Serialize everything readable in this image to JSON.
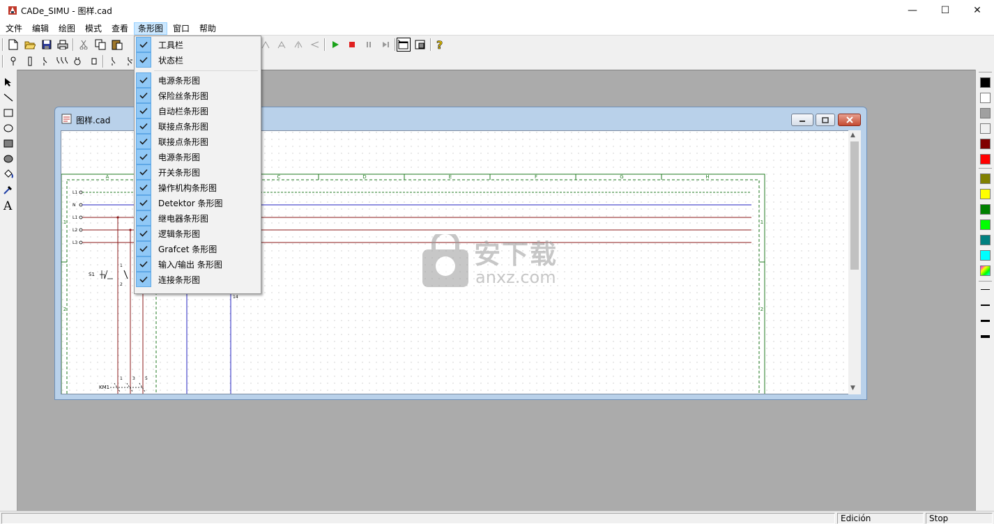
{
  "window": {
    "title": "CADe_SIMU - 图样.cad",
    "minimize": "—",
    "maximize": "☐",
    "close": "✕"
  },
  "menu": [
    {
      "label": "文件"
    },
    {
      "label": "编辑"
    },
    {
      "label": "绘图"
    },
    {
      "label": "模式"
    },
    {
      "label": "查看"
    },
    {
      "label": "条形图",
      "active": true
    },
    {
      "label": "窗口"
    },
    {
      "label": "帮助"
    }
  ],
  "dropdown": {
    "group1": [
      "工具栏",
      "状态栏"
    ],
    "group2": [
      "电源条形图",
      "保险丝条形图",
      "自动栏条形图",
      "联接点条形图",
      "联接点条形图",
      "电源条形图",
      "开关条形图",
      "操作机构条形图",
      "Detektor 条形图",
      "继电器条形图",
      "逻辑条形图",
      "Grafcet 条形图",
      "输入/输出 条形图",
      "连接条形图"
    ]
  },
  "document": {
    "title": "图样.cad",
    "columns": [
      "A",
      "B",
      "C",
      "D",
      "E",
      "F",
      "G",
      "H"
    ],
    "rows": [
      "1",
      "2"
    ],
    "rails": [
      "L1",
      "N",
      "L1",
      "L2",
      "L3"
    ],
    "labels": {
      "s1": "S1",
      "km1": "KM1",
      "n14": "14",
      "n1": "1",
      "n2": "2",
      "n1b": "1",
      "n3": "3",
      "n5": "5"
    }
  },
  "watermark": {
    "text": "安下载",
    "domain": "anxz.com"
  },
  "palette": [
    "#000000",
    "#ffffff",
    "#a0a0a0",
    "#f0f0f0",
    "#800000",
    "#ff0000",
    "#808000",
    "#ffff00",
    "#008000",
    "#00ff00",
    "#008080",
    "#00ffff"
  ],
  "status": {
    "mode": "Edición",
    "run": "Stop"
  }
}
